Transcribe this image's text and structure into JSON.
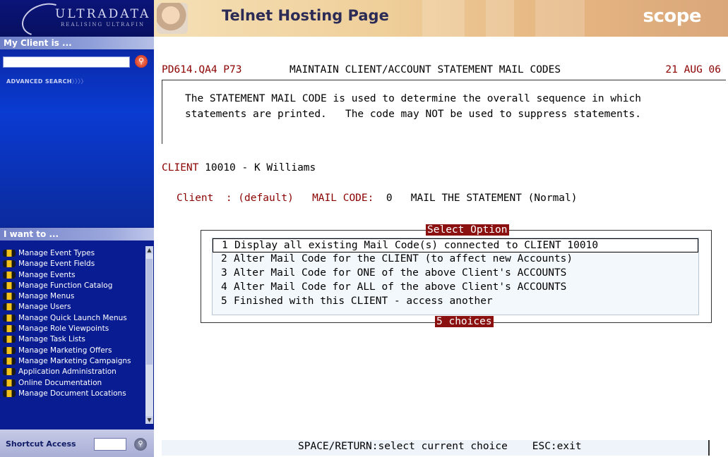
{
  "sidebar": {
    "logo_text": "ULTRADATA",
    "logo_tagline": "REALISING ULTRAFIN",
    "client_header": "My Client is ...",
    "client_search_value": "",
    "advanced_search": "ADVANCED SEARCH",
    "advanced_search_chevrons": "〉〉〉〉",
    "iwant_header": "I want to ...",
    "menu_items": [
      {
        "label": "Manage Event Types"
      },
      {
        "label": "Manage Event Fields"
      },
      {
        "label": "Manage Events"
      },
      {
        "label": "Manage Function Catalog"
      },
      {
        "label": "Manage Menus"
      },
      {
        "label": "Manage Users"
      },
      {
        "label": "Manage Quick Launch Menus"
      },
      {
        "label": "Manage Role Viewpoints"
      },
      {
        "label": "Manage Task Lists"
      },
      {
        "label": "Manage Marketing Offers"
      },
      {
        "label": "Manage Marketing Campaigns"
      },
      {
        "label": "Application Administration"
      },
      {
        "label": "Online Documentation"
      },
      {
        "label": "Manage Document Locations"
      }
    ],
    "shortcut_label": "Shortcut Access",
    "shortcut_value": ""
  },
  "header": {
    "title": "Telnet Hosting Page",
    "scope_logo": "scope"
  },
  "terminal": {
    "status_left": "PD614.QA4 P73",
    "status_center": "MAINTAIN CLIENT/ACCOUNT STATEMENT MAIL CODES",
    "status_right": "21 AUG 06",
    "info_line1": "The STATEMENT MAIL CODE is used to determine the overall sequence in which",
    "info_line2": "statements are printed.   The code may NOT be used to suppress statements.",
    "client_label": "CLIENT",
    "client_value": "10010 - K Williams",
    "mail_client_label": "Client  : (default)",
    "mail_code_label": "MAIL CODE:",
    "mail_code_value": "0",
    "mail_code_desc": "MAIL THE STATEMENT (Normal)",
    "option_title": "Select Option",
    "options": [
      {
        "num": "1",
        "label": "Display all existing Mail Code(s) connected to CLIENT 10010",
        "selected": true
      },
      {
        "num": "2",
        "label": "Alter Mail Code for the CLIENT (to affect new Accounts)",
        "selected": false
      },
      {
        "num": "3",
        "label": "Alter Mail Code for ONE of the above Client's ACCOUNTS",
        "selected": false
      },
      {
        "num": "4",
        "label": "Alter Mail Code for ALL of the above Client's ACCOUNTS",
        "selected": false
      },
      {
        "num": "5",
        "label": "Finished with this CLIENT - access another",
        "selected": false
      }
    ],
    "option_footer": "5 choices",
    "footer_text": "SPACE/RETURN:select current choice    ESC:exit"
  }
}
